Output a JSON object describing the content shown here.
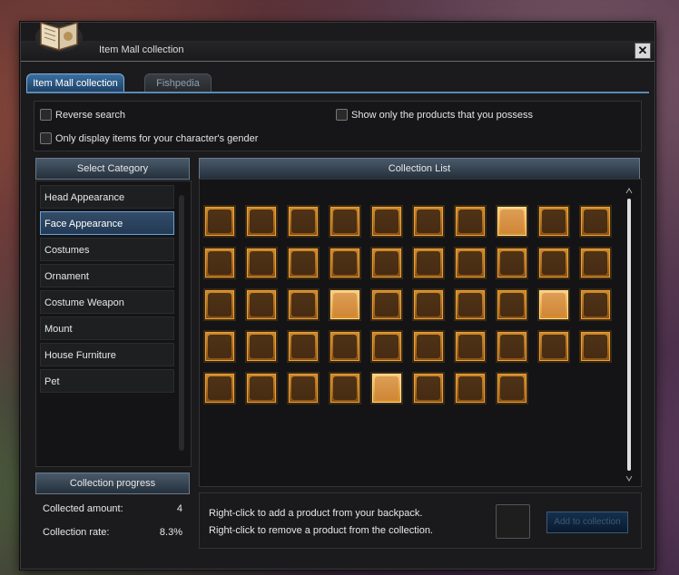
{
  "window": {
    "title": "Item Mall collection",
    "close_label": "✕"
  },
  "tabs": [
    {
      "label": "Item Mall collection",
      "active": true
    },
    {
      "label": "Fishpedia",
      "active": false
    }
  ],
  "options": {
    "reverse_search": "Reverse search",
    "own_only": "Show only the products that you possess",
    "gender_only": "Only display items for your character's gender"
  },
  "category": {
    "header": "Select Category",
    "items": [
      {
        "label": "Head Appearance",
        "selected": false
      },
      {
        "label": "Face Appearance",
        "selected": true
      },
      {
        "label": "Costumes",
        "selected": false
      },
      {
        "label": "Ornament",
        "selected": false
      },
      {
        "label": "Costume Weapon",
        "selected": false
      },
      {
        "label": "Mount",
        "selected": false
      },
      {
        "label": "House Furniture",
        "selected": false
      },
      {
        "label": "Pet",
        "selected": false
      }
    ]
  },
  "collection_list": {
    "header": "Collection List",
    "rows": [
      [
        {
          "icon": "mask-icon"
        },
        {
          "icon": "mask-icon"
        },
        {
          "icon": "mask-icon"
        },
        {
          "icon": "goggles-icon"
        },
        {
          "icon": "cap-icon"
        },
        {
          "icon": "face-icon"
        },
        {
          "icon": "doll-icon"
        },
        {
          "icon": "ears-icon",
          "bright": true
        },
        {
          "icon": "ears-icon"
        },
        {
          "icon": "ears-icon"
        }
      ],
      [
        {
          "icon": "brush-icon"
        },
        {
          "icon": "mask-icon"
        },
        {
          "icon": "mask-icon"
        },
        {
          "icon": "hat-icon"
        },
        {
          "icon": "mask-icon"
        },
        {
          "icon": "pendant-icon"
        },
        {
          "icon": "bottle-icon"
        },
        {
          "icon": "bottle-icon"
        },
        {
          "icon": "mirror-icon"
        },
        {
          "icon": "face-icon"
        }
      ],
      [
        {
          "icon": "face-icon"
        },
        {
          "icon": "mask-icon"
        },
        {
          "icon": "mask-icon"
        },
        {
          "icon": "cat-mask-icon",
          "bright": true
        },
        {
          "icon": "monocle-icon"
        },
        {
          "icon": "mask-icon"
        },
        {
          "icon": "doll-icon"
        },
        {
          "icon": "hammer-icon"
        },
        {
          "icon": "ring-icon",
          "bright": true
        },
        {
          "icon": "bottle-icon"
        }
      ],
      [
        {
          "icon": "glasses-icon"
        },
        {
          "icon": "glasses-icon"
        },
        {
          "icon": "wand-icon"
        },
        {
          "icon": "goggles-icon"
        },
        {
          "icon": "visor-icon"
        },
        {
          "icon": "glasses-icon"
        },
        {
          "icon": "sunglasses-icon"
        },
        {
          "icon": "kunai-icon"
        },
        {
          "icon": "rose-icon"
        },
        {
          "icon": "mask-icon"
        }
      ],
      [
        {
          "icon": "helmet-icon"
        },
        {
          "icon": "star-mask-icon"
        },
        {
          "icon": "flag-icon"
        },
        {
          "icon": "bag-icon"
        },
        {
          "icon": "cat-mask-icon",
          "bright": true
        },
        {
          "icon": "scroll-icon"
        },
        {
          "icon": "mask-icon"
        },
        {
          "icon": "pet-icon"
        }
      ]
    ]
  },
  "progress": {
    "header": "Collection progress",
    "collected_label": "Collected amount:",
    "collected_value": "4",
    "rate_label": "Collection rate:",
    "rate_value": "8.3%"
  },
  "bottom": {
    "hint1": "Right-click to add a product from your backpack.",
    "hint2": "Right-click to remove a product from the collection.",
    "add_button": "Add to collection"
  }
}
